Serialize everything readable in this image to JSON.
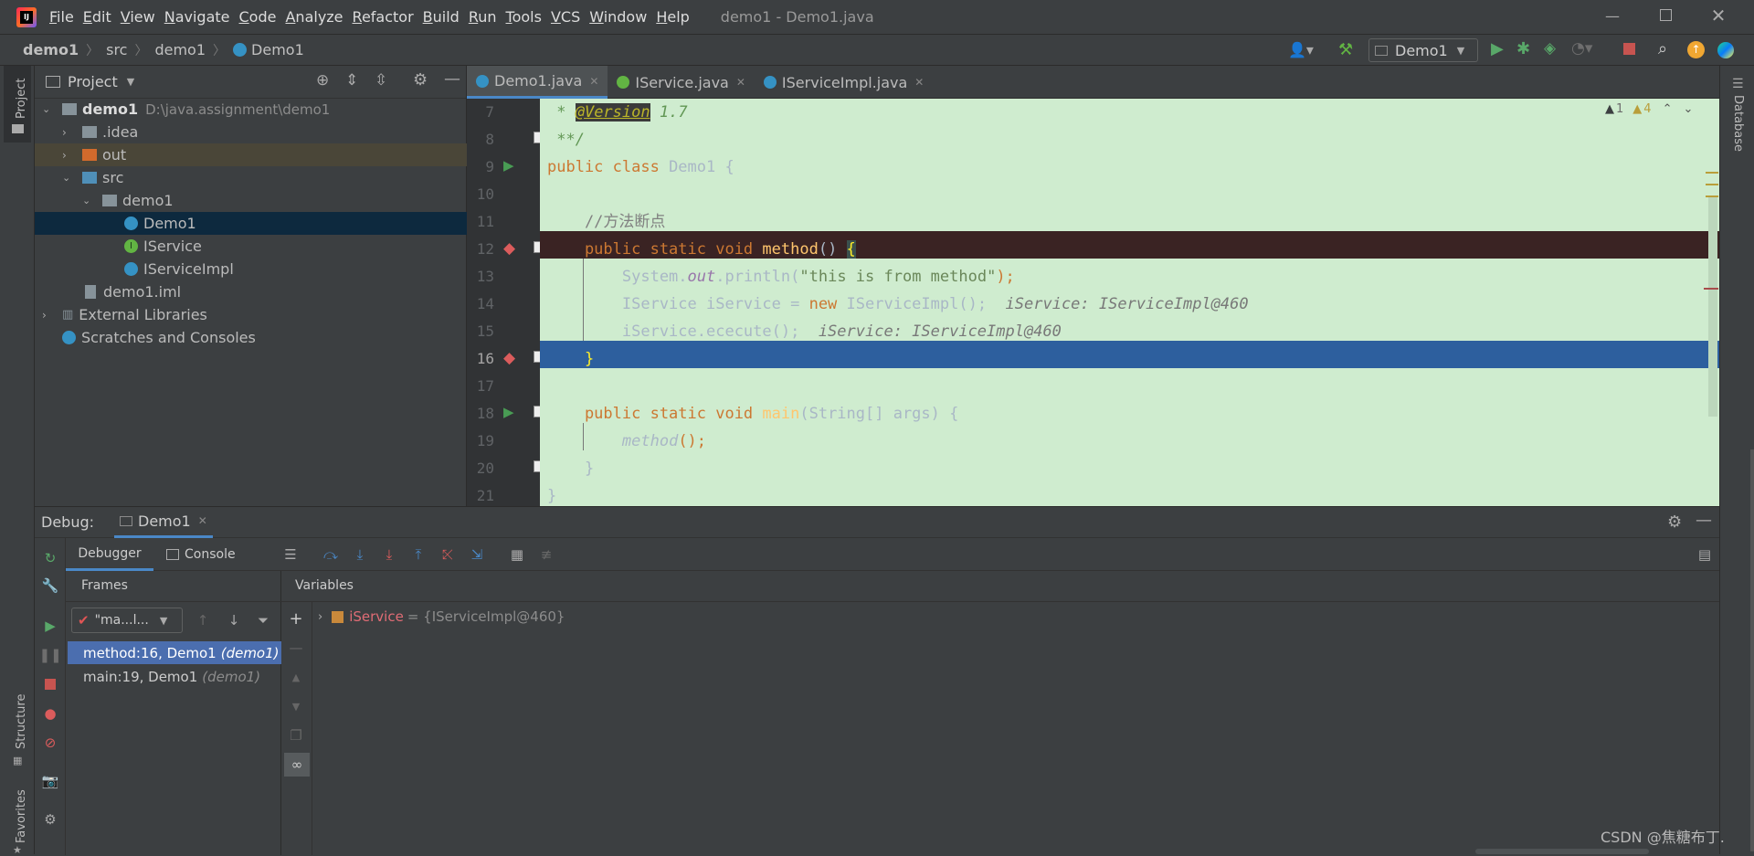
{
  "menu": [
    "File",
    "Edit",
    "View",
    "Navigate",
    "Code",
    "Analyze",
    "Refactor",
    "Build",
    "Run",
    "Tools",
    "VCS",
    "Window",
    "Help"
  ],
  "window_title": "demo1 - Demo1.java",
  "breadcrumb": [
    "demo1",
    "src",
    "demo1",
    "Demo1"
  ],
  "run_config": "Demo1",
  "project": {
    "title": "Project",
    "root": "demo1",
    "root_path": "D:\\java.assignment\\demo1",
    "items": [
      {
        "label": "demo1",
        "extra": "D:\\java.assignment\\demo1"
      },
      {
        "label": ".idea"
      },
      {
        "label": "out"
      },
      {
        "label": "src"
      },
      {
        "label": "demo1"
      },
      {
        "label": "Demo1"
      },
      {
        "label": "IService"
      },
      {
        "label": "IServiceImpl"
      },
      {
        "label": "demo1.iml"
      },
      {
        "label": "External Libraries"
      },
      {
        "label": "Scratches and Consoles"
      }
    ]
  },
  "left_strip": {
    "project": "Project",
    "structure": "Structure",
    "favorites": "Favorites"
  },
  "right_strip": {
    "database": "Database"
  },
  "editor_tabs": [
    "Demo1.java",
    "IService.java",
    "IServiceImpl.java"
  ],
  "inspections": {
    "errors": "1",
    "warnings": "4"
  },
  "code": {
    "line_numbers": [
      "7",
      "8",
      "9",
      "10",
      "11",
      "12",
      "13",
      "14",
      "15",
      "16",
      "17",
      "18",
      "19",
      "20",
      "21"
    ],
    "lines": {
      "l7a": " * ",
      "l7b": "@Version",
      "l7c": " 1.7",
      "l8": " **/",
      "l9a": "public class ",
      "l9b": "Demo1 {",
      "l11": "    //方法断点",
      "l12a": "    public static void ",
      "l12b": "method",
      "l12c": "() ",
      "l12d": "{",
      "l13a": "        System.",
      "l13b": "out",
      "l13c": ".println(",
      "l13d": "\"this is from method\"",
      "l13e": ");",
      "l14a": "        IService iService = ",
      "l14b": "new",
      "l14c": " IServiceImpl();",
      "l14d": "  iService: IServiceImpl@460",
      "l15a": "        iService.ececute();",
      "l15b": "  iService: IServiceImpl@460",
      "l16": "    }",
      "l18a": "    public static void ",
      "l18b": "main",
      "l18c": "(String[] args) {",
      "l19a": "        ",
      "l19b": "method",
      "l19c": "();",
      "l20": "    }",
      "l21": "}"
    }
  },
  "debug": {
    "label": "Debug:",
    "config": "Demo1",
    "tabs": [
      "Debugger",
      "Console"
    ],
    "frames_title": "Frames",
    "variables_title": "Variables",
    "thread": "\"ma...l...",
    "frames": [
      {
        "label": "method:16, Demo1",
        "module": "(demo1)"
      },
      {
        "label": "main:19, Demo1",
        "module": "(demo1)"
      }
    ],
    "variable": {
      "name": "iService",
      "value": "= {IServiceImpl@460}"
    }
  },
  "watermark": "CSDN @焦糖布丁.",
  "colors": {
    "bg": "#3c3f41",
    "editor_bg": "#cfeccf",
    "breakpoint_line": "#3a2323",
    "exec_line": "#2d5f9e",
    "selected_frame": "#4b6eaf"
  }
}
